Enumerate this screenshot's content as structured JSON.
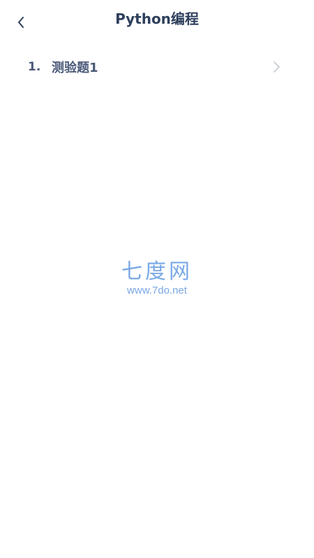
{
  "header": {
    "title": "Python编程"
  },
  "quizzes": [
    {
      "index": "1.",
      "name": "测验题1"
    }
  ],
  "watermark": {
    "logo_text": "七度网",
    "url": "www.7do.net"
  },
  "colors": {
    "title": "#2e3f5c",
    "item_text": "#4a5878",
    "watermark": "#7aa8e6",
    "chevron": "#c8ccd4"
  },
  "icons": {
    "back": "chevron-left-icon",
    "item_arrow": "chevron-right-icon"
  }
}
